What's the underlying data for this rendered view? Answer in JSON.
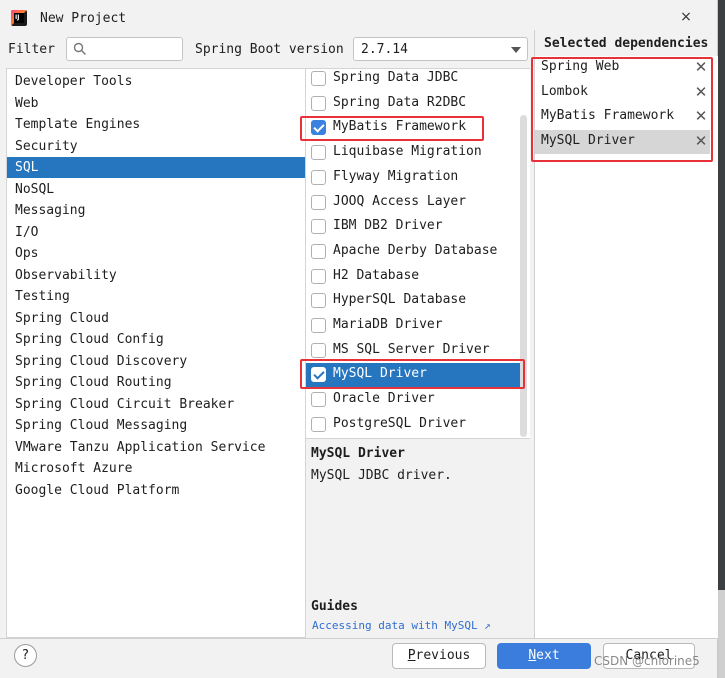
{
  "window": {
    "title": "New Project",
    "close_glyph": "×"
  },
  "filter": {
    "label": "Filter",
    "value": "",
    "search_glyph": "Q"
  },
  "spring_boot": {
    "label": "Spring Boot version",
    "value": "2.7.14"
  },
  "categories": [
    "Developer Tools",
    "Web",
    "Template Engines",
    "Security",
    "SQL",
    "NoSQL",
    "Messaging",
    "I/O",
    "Ops",
    "Observability",
    "Testing",
    "Spring Cloud",
    "Spring Cloud Config",
    "Spring Cloud Discovery",
    "Spring Cloud Routing",
    "Spring Cloud Circuit Breaker",
    "Spring Cloud Messaging",
    "VMware Tanzu Application Service",
    "Microsoft Azure",
    "Google Cloud Platform"
  ],
  "selected_category": "SQL",
  "dependencies": [
    {
      "label": "Spring Data JDBC",
      "checked": false
    },
    {
      "label": "Spring Data R2DBC",
      "checked": false
    },
    {
      "label": "MyBatis Framework",
      "checked": true
    },
    {
      "label": "Liquibase Migration",
      "checked": false
    },
    {
      "label": "Flyway Migration",
      "checked": false
    },
    {
      "label": "JOOQ Access Layer",
      "checked": false
    },
    {
      "label": "IBM DB2 Driver",
      "checked": false
    },
    {
      "label": "Apache Derby Database",
      "checked": false
    },
    {
      "label": "H2 Database",
      "checked": false
    },
    {
      "label": "HyperSQL Database",
      "checked": false
    },
    {
      "label": "MariaDB Driver",
      "checked": false
    },
    {
      "label": "MS SQL Server Driver",
      "checked": false
    },
    {
      "label": "MySQL Driver",
      "checked": true,
      "highlighted": true
    },
    {
      "label": "Oracle Driver",
      "checked": false
    },
    {
      "label": "PostgreSQL Driver",
      "checked": false
    }
  ],
  "description": {
    "title": "MySQL Driver",
    "text": "MySQL JDBC driver.",
    "guides_label": "Guides",
    "guide_link": "Accessing data with MySQL ↗"
  },
  "selected_dependencies": {
    "title": "Selected dependencies",
    "remove_glyph": "✕",
    "items": [
      "Spring Web",
      "Lombok",
      "MyBatis Framework",
      "MySQL Driver"
    ]
  },
  "buttons": {
    "help": "?",
    "previous": "Previous",
    "next": "Next",
    "cancel": "Cancel"
  },
  "watermark": "CSDN @chlorine5",
  "colors": {
    "selection": "#2675bf",
    "primary_button": "#3b7ddd",
    "annotation_red": "#e8323a",
    "checkbox_blue": "#3b82e0"
  }
}
